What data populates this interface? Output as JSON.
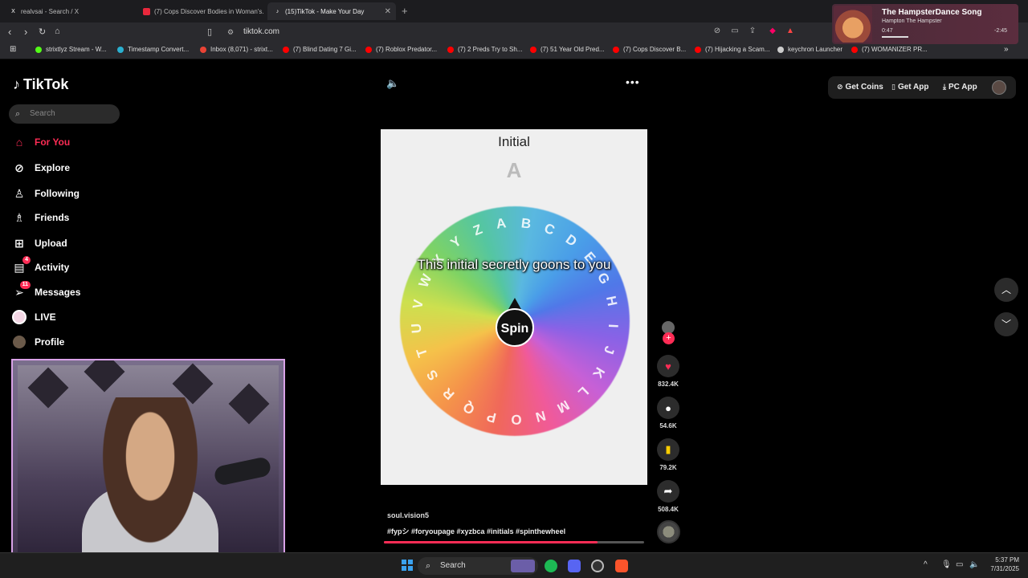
{
  "browser": {
    "tabs": [
      {
        "label": "realvsai - Search / X",
        "icon": "x-logo-icon"
      },
      {
        "label": "(7) Cops Discover Bodies in Woman's...",
        "icon": "youtube-icon"
      },
      {
        "label": "(15)TikTok - Make Your Day",
        "icon": "tiktok-icon",
        "active": true
      }
    ],
    "url": "tiktok.com",
    "bookmarks": [
      {
        "label": "strixtlyz Stream - W...",
        "color": "#53fc18"
      },
      {
        "label": "Timestamp Convert...",
        "color": "#2ab0d0"
      },
      {
        "label": "Inbox (8,071) - strixt...",
        "color": "#ea4335"
      },
      {
        "label": "(7) Blind Dating 7 Gi...",
        "color": "#ff0000"
      },
      {
        "label": "(7) Roblox Predator...",
        "color": "#ff0000"
      },
      {
        "label": "(7) 2 Preds Try to Sh...",
        "color": "#ff0000"
      },
      {
        "label": "(7) 51 Year Old Pred...",
        "color": "#ff0000"
      },
      {
        "label": "(7) Cops Discover B...",
        "color": "#ff0000"
      },
      {
        "label": "(7) Hijacking a Scam...",
        "color": "#ff0000"
      },
      {
        "label": "keychron Launcher",
        "color": "#cccccc"
      },
      {
        "label": "(7) WOMANIZER PR...",
        "color": "#ff0000"
      }
    ]
  },
  "media": {
    "title": "The HampsterDance Song",
    "artist": "Hampton The Hampster",
    "elapsed": "0:47",
    "remaining": "-2:45",
    "progress": 0.22
  },
  "tiktok": {
    "logo": "TikTok",
    "search_placeholder": "Search",
    "nav": [
      {
        "label": "For You",
        "icon": "home-icon",
        "active": true
      },
      {
        "label": "Explore",
        "icon": "compass-icon"
      },
      {
        "label": "Following",
        "icon": "following-icon"
      },
      {
        "label": "Friends",
        "icon": "friends-icon"
      },
      {
        "label": "Upload",
        "icon": "upload-icon"
      },
      {
        "label": "Activity",
        "icon": "activity-icon",
        "badge": "4"
      },
      {
        "label": "Messages",
        "icon": "messages-icon",
        "badge": "11"
      },
      {
        "label": "LIVE",
        "icon": "live-icon"
      },
      {
        "label": "Profile",
        "icon": "profile-avatar"
      }
    ],
    "top_actions": {
      "coins": "Get Coins",
      "app": "Get App",
      "pc": "PC App"
    },
    "video": {
      "title": "Initial",
      "result_letter": "A",
      "caption": "This initial secretly goons to you",
      "spin": "Spin",
      "wheel_letters": [
        "A",
        "B",
        "C",
        "D",
        "E",
        "G",
        "H",
        "I",
        "J",
        "K",
        "L",
        "M",
        "N",
        "O",
        "P",
        "Q",
        "R",
        "S",
        "T",
        "U",
        "V",
        "W",
        "X",
        "Y",
        "Z"
      ]
    },
    "actions": {
      "likes": "832.4K",
      "comments": "54.6K",
      "saves": "79.2K",
      "shares": "508.4K"
    },
    "author": "soul.vision5",
    "hashtags": "#fypシ #foryoupage #xyzbca #initials #spinthewheel",
    "video_progress": 0.82
  },
  "taskbar": {
    "search": "Search",
    "time": "5:37 PM",
    "date": "7/31/2025"
  }
}
